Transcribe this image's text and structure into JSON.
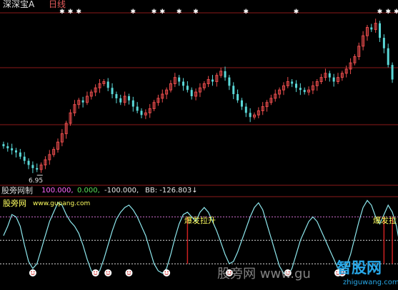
{
  "header": {
    "stock_name": "深深宝A",
    "period": "日线"
  },
  "price_panel": {
    "low_label": "6.95",
    "colors": {
      "up": "#e84c4c",
      "down": "#5ad8d8",
      "frame": "#8b1a1a",
      "background": "#000000",
      "marker": "#ffffff"
    }
  },
  "indicator_panel": {
    "name": "股旁网制",
    "values": [
      "100.000,",
      "0.000,",
      "-100.000,",
      "BB: -126.803↓"
    ],
    "value_colors": [
      "#ff66ff",
      "#58e058",
      "#e6e6e6",
      "#e6e6e6"
    ],
    "site_name": "股旁网",
    "site_url": "www.gupang.com",
    "signal_text_1": "爆发拉升",
    "signal_text_2": "爆发拉",
    "line_color": "#8ee8ee",
    "upper_level_color": "#d070d0",
    "signal_bar_color": "#cc2020",
    "face_color": "#ffffff"
  },
  "watermarks": {
    "left": "股旁网 www.gu",
    "logo": "智股网",
    "logo_url": "zhiguwang.com"
  },
  "chart_data": [
    {
      "type": "candlestick",
      "series": "price",
      "close": [
        8.1,
        8.0,
        7.9,
        7.8,
        7.6,
        7.4,
        7.2,
        7.05,
        6.98,
        7.2,
        7.45,
        7.7,
        7.95,
        8.3,
        8.7,
        9.2,
        9.7,
        10.1,
        10.3,
        10.2,
        10.5,
        10.7,
        10.9,
        11.1,
        11.2,
        10.9,
        10.6,
        10.4,
        10.2,
        10.5,
        10.3,
        10.0,
        9.8,
        9.6,
        9.7,
        9.9,
        10.2,
        10.4,
        10.6,
        10.8,
        11.1,
        11.4,
        11.2,
        11.0,
        10.8,
        10.5,
        10.7,
        10.9,
        11.1,
        11.3,
        11.2,
        11.5,
        11.7,
        11.4,
        11.0,
        10.6,
        10.3,
        10.0,
        9.7,
        9.5,
        9.6,
        9.8,
        10.0,
        10.2,
        10.4,
        10.6,
        10.8,
        11.0,
        11.2,
        11.1,
        10.9,
        10.8,
        10.7,
        10.8,
        11.0,
        11.2,
        11.4,
        11.6,
        11.4,
        11.2,
        11.4,
        11.6,
        11.8,
        12.1,
        12.4,
        12.9,
        13.4,
        13.8,
        13.7,
        14.0,
        13.3,
        12.8,
        12.0,
        11.3
      ]
    },
    {
      "type": "line",
      "series": "indicator",
      "levels": [
        100,
        0,
        -100
      ],
      "values": [
        20,
        60,
        110,
        100,
        60,
        -20,
        -90,
        -120,
        -100,
        -40,
        20,
        80,
        120,
        160,
        150,
        110,
        80,
        60,
        30,
        -20,
        -80,
        -130,
        -150,
        -130,
        -80,
        -20,
        40,
        90,
        120,
        140,
        150,
        130,
        100,
        60,
        20,
        -40,
        -100,
        -130,
        -140,
        -120,
        -60,
        10,
        70,
        110,
        120,
        100,
        80,
        120,
        140,
        120,
        80,
        40,
        -10,
        -60,
        -100,
        -90,
        -50,
        0,
        50,
        100,
        140,
        160,
        130,
        70,
        10,
        -50,
        -110,
        -140,
        -150,
        -120,
        -60,
        0,
        40,
        80,
        100,
        80,
        40,
        0,
        -40,
        -80,
        -120,
        -130,
        -110,
        -60,
        10,
        80,
        140,
        170,
        150,
        100,
        70,
        110,
        150,
        120,
        60,
        -40,
        -120
      ]
    }
  ]
}
